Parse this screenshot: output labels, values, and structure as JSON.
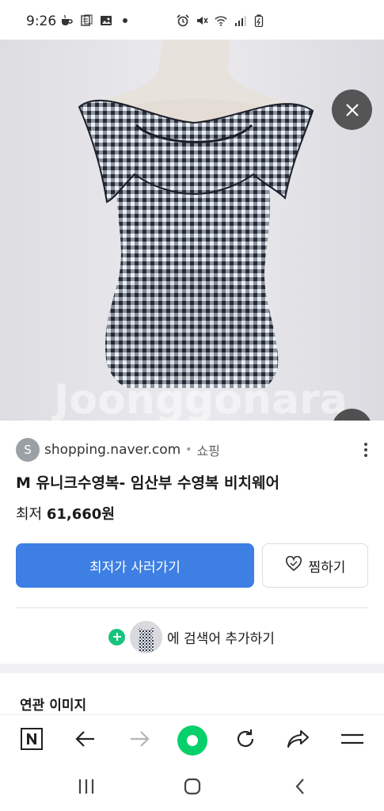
{
  "status_bar": {
    "time": "9:26",
    "left_icons": [
      "coffee-icon",
      "notes-icon",
      "gallery-icon",
      "dot-icon"
    ],
    "right_icons": [
      "alarm-icon",
      "mute-icon",
      "wifi-icon",
      "signal-icon",
      "battery-icon"
    ]
  },
  "viewer": {
    "close_icon": "close-icon",
    "lens_icon": "image-search-icon",
    "watermark": "Joonggonara"
  },
  "result": {
    "source_initial": "S",
    "source_domain": "shopping.naver.com",
    "source_separator": "•",
    "source_category": "쇼핑",
    "title": "M 유니크수영복- 임산부 수영복 비치웨어",
    "price_label": "최저",
    "price_value": "61,660원",
    "buy_label": "최저가 사러가기",
    "wish_label": "찜하기",
    "add_search_label": "에 검색어 추가하기"
  },
  "related": {
    "title": "연관 이미지"
  },
  "toolbar": {
    "items": [
      "naver-home-icon",
      "back-arrow-icon",
      "forward-arrow-icon",
      "green-dot-icon",
      "refresh-icon",
      "share-icon",
      "menu-icon"
    ]
  },
  "system_nav": {
    "items": [
      "recents-icon",
      "home-icon",
      "back-icon"
    ]
  },
  "colors": {
    "accent_blue": "#3d7fe3",
    "naver_green": "#07d06a",
    "plus_green": "#19c37d"
  }
}
